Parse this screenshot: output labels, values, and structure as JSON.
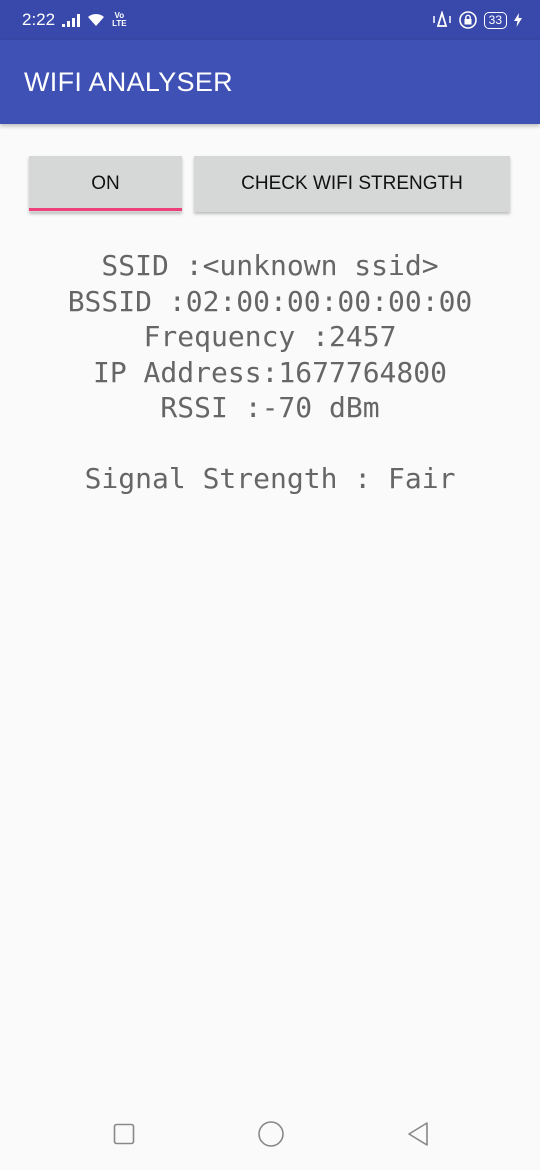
{
  "status_bar": {
    "time": "2:22",
    "volte_top": "Vo",
    "volte_bottom": "LTE",
    "battery": "33"
  },
  "app_bar": {
    "title": "WIFI ANALYSER"
  },
  "buttons": {
    "on_label": "ON",
    "check_label": "CHECK WIFI STRENGTH"
  },
  "info": {
    "ssid": "SSID :<unknown ssid>",
    "bssid": "BSSID :02:00:00:00:00:00",
    "frequency": "Frequency :2457",
    "ip": "IP Address:1677764800",
    "rssi": "RSSI :-70 dBm",
    "strength": "Signal Strength : Fair"
  },
  "colors": {
    "primary": "#3f51b5",
    "primary_dark": "#3949ab",
    "accent": "#ec407a"
  },
  "icons": {
    "status": [
      "signal-icon",
      "wifi-icon",
      "alarm-icon",
      "lock-icon",
      "battery-icon",
      "charging-icon"
    ],
    "nav": [
      "recents-icon",
      "home-icon",
      "back-icon"
    ]
  }
}
